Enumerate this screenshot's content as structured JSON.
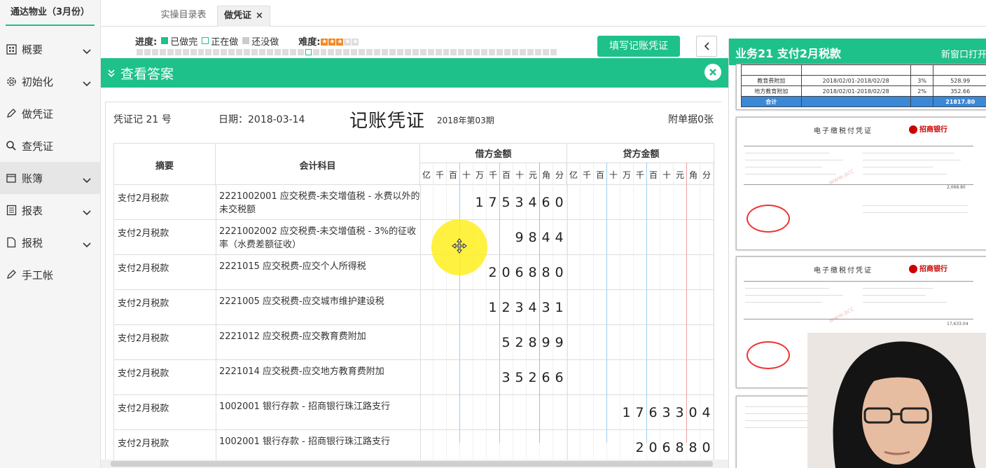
{
  "sidebar": {
    "company": "通达物业（3月份）",
    "items": [
      {
        "label": "概要",
        "icon": "grid-icon",
        "has_chevron": true
      },
      {
        "label": "初始化",
        "icon": "gear-icon",
        "has_chevron": true
      },
      {
        "label": "做凭证",
        "icon": "pen-icon",
        "has_chevron": false
      },
      {
        "label": "查凭证",
        "icon": "search-icon",
        "has_chevron": false
      },
      {
        "label": "账簿",
        "icon": "book-icon",
        "has_chevron": true
      },
      {
        "label": "报表",
        "icon": "list-icon",
        "has_chevron": true
      },
      {
        "label": "报税",
        "icon": "document-icon",
        "has_chevron": true
      },
      {
        "label": "手工帐",
        "icon": "pen-icon",
        "has_chevron": false
      }
    ]
  },
  "tabs": [
    {
      "label": "实操目录表"
    },
    {
      "label": "做凭证",
      "close": "×"
    }
  ],
  "progress": {
    "label": "进度:",
    "legend": [
      "已做完",
      "正在做",
      "还没做"
    ],
    "difficulty_label": "难度:",
    "difficulty_level": 3,
    "difficulty_max": 5
  },
  "buttons": {
    "fill_voucher": "填写记账凭证"
  },
  "answer_bar": {
    "title": "查看答案"
  },
  "voucher": {
    "number": "凭证记 21 号",
    "date": "日期：2018-03-14",
    "title": "记账凭证",
    "period": "2018年第03期",
    "attachments": "附单据0张",
    "headers": {
      "summary": "摘要",
      "account": "会计科目",
      "debit": "借方金额",
      "credit": "贷方金额"
    },
    "units": [
      "亿",
      "千",
      "百",
      "十",
      "万",
      "千",
      "百",
      "十",
      "元",
      "角",
      "分"
    ],
    "rows": [
      {
        "summary": "支付2月税款",
        "account": "2221002001 应交税费-未交增值税 - 水费以外的未交税额",
        "debit": "1753460",
        "credit": ""
      },
      {
        "summary": "支付2月税款",
        "account": "2221002002 应交税费-未交增值税 - 3%的征收率（水费差额征收）",
        "debit": "9844",
        "credit": ""
      },
      {
        "summary": "支付2月税款",
        "account": "2221015 应交税费-应交个人所得税",
        "debit": "206880",
        "credit": ""
      },
      {
        "summary": "支付2月税款",
        "account": "2221005 应交税费-应交城市维护建设税",
        "debit": "123431",
        "credit": ""
      },
      {
        "summary": "支付2月税款",
        "account": "2221012 应交税费-应交教育费附加",
        "debit": "52899",
        "credit": ""
      },
      {
        "summary": "支付2月税款",
        "account": "2221014 应交税费-应交地方教育费附加",
        "debit": "35266",
        "credit": ""
      },
      {
        "summary": "支付2月税款",
        "account": "1002001 银行存款 - 招商银行珠江路支行",
        "debit": "",
        "credit": "1763304"
      },
      {
        "summary": "支付2月税款",
        "account": "1002001 银行存款 - 招商银行珠江路支行",
        "debit": "",
        "credit": "206880"
      }
    ]
  },
  "right_panel": {
    "title": "业务21 支付2月税款",
    "open_new": "新窗口打开",
    "tax_table": [
      [
        "教育费附加",
        "2018/02/01-2018/02/28",
        "3%",
        "528.99"
      ],
      [
        "地方教育附加",
        "2018/02/01-2018/02/28",
        "2%",
        "352.66"
      ]
    ],
    "tax_total": [
      "合计",
      "21817.80"
    ],
    "receipt_title": "电子缴税付凭证",
    "bank": "招商银行",
    "receipt_amounts": [
      "2,068.80",
      "17,633.04"
    ]
  },
  "colors": {
    "accent": "#1ec18a",
    "highlight": "#ffee1e"
  }
}
